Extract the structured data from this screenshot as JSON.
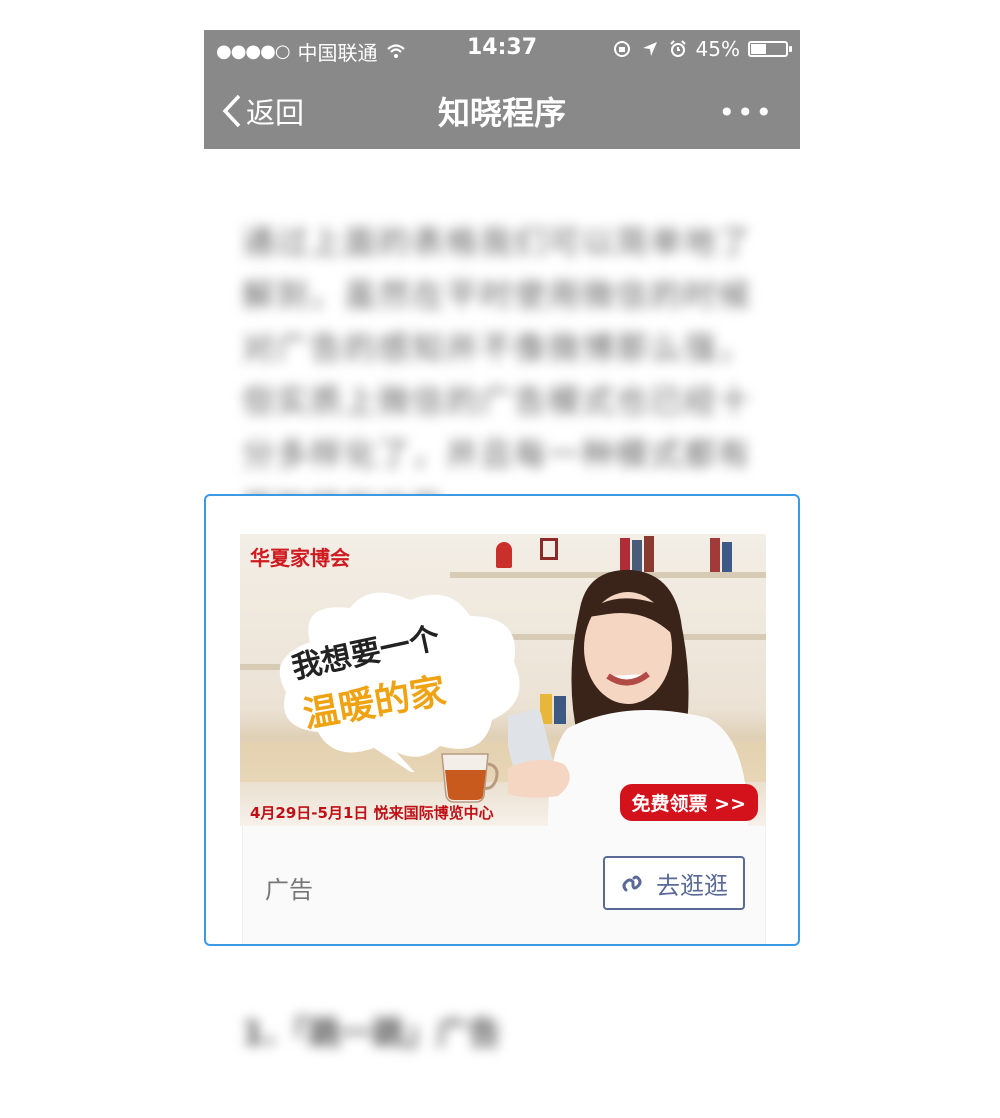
{
  "status": {
    "carrier": "中国联通",
    "time": "14:37",
    "battery": "45%"
  },
  "nav": {
    "back_label": "返回",
    "title": "知晓程序",
    "more": "•••"
  },
  "article": {
    "paragraph": "通过上面的表格我们可以简单地了解到，虽然在平时使用微信的时候对广告的感知并不像微博那么强，但实质上微信的广告模式也已经十分多样化了，并且每一种模式都有其独特的功能。",
    "heading": "1.「跳一跳」广告"
  },
  "ad": {
    "brand": "华夏家博会",
    "slogan_line1": "我想要一个",
    "slogan_line2": "温暖的家",
    "dates": "4月29日-5月1日  悦来国际博览中心",
    "ticket": "免费领票 >>",
    "label": "广告",
    "go_button": "去逛逛"
  },
  "colors": {
    "topbar": "#898989",
    "accent_border": "#3b9ae8",
    "brand_red": "#d01a1f",
    "slogan_orange": "#f0a312",
    "button_text": "#5a6a97"
  },
  "battery_level": 0.45
}
